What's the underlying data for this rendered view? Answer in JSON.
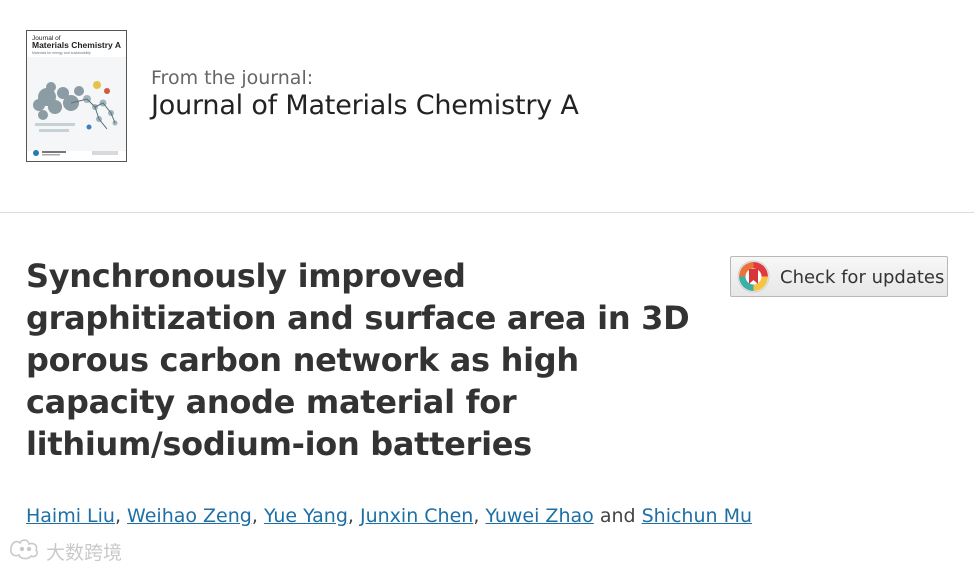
{
  "journal": {
    "from_label": "From the journal:",
    "name": "Journal of Materials Chemistry A",
    "cover": {
      "line1": "Journal of",
      "line2": "Materials Chemistry A",
      "subtitle": "Materials for energy and sustainability"
    }
  },
  "article": {
    "title_lines": [
      "Synchronously improved",
      "graphitization and surface area in 3D",
      "porous carbon network as high",
      "capacity anode material for",
      "lithium/sodium-ion batteries"
    ]
  },
  "check_updates": {
    "label": "Check for updates",
    "icon": "crossmark-icon"
  },
  "authors": {
    "names": [
      "Haimi Liu",
      "Weihao Zeng",
      "Yue Yang",
      "Junxin Chen",
      "Yuwei Zhao",
      "Shichun Mu"
    ],
    "conjunction": "and"
  },
  "watermark": {
    "text": "大数跨境"
  },
  "colors": {
    "link": "#1d6fa5",
    "title": "#333333",
    "divider": "#dcdcdc"
  }
}
